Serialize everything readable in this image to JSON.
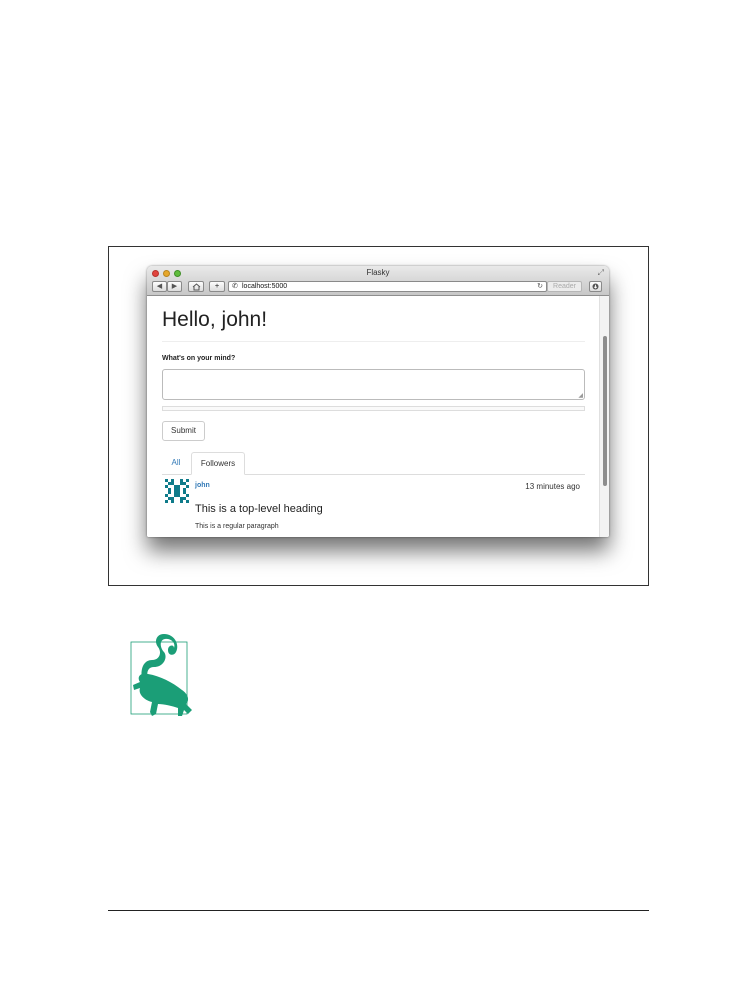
{
  "browser": {
    "window_title": "Flasky",
    "address_url": "localhost:5000",
    "reader_label": "Reader",
    "icons": {
      "back": "back-arrow-icon",
      "forward": "forward-arrow-icon",
      "home": "home-icon",
      "add": "plus-icon",
      "reload": "reload-icon",
      "downloads": "downloads-icon"
    }
  },
  "page": {
    "greeting": "Hello, john!",
    "form": {
      "label": "What's on your mind?",
      "body_value": "",
      "submit_label": "Submit"
    },
    "tabs": [
      {
        "label": "All",
        "active": false
      },
      {
        "label": "Followers",
        "active": true
      }
    ],
    "posts": [
      {
        "author": "john",
        "timestamp": "13 minutes ago",
        "heading": "This is a top-level heading",
        "paragraph": "This is a regular paragraph"
      }
    ]
  },
  "colors": {
    "link": "#337ab7",
    "avatar": "#0f7b8a",
    "animal": "#1b9e77"
  }
}
